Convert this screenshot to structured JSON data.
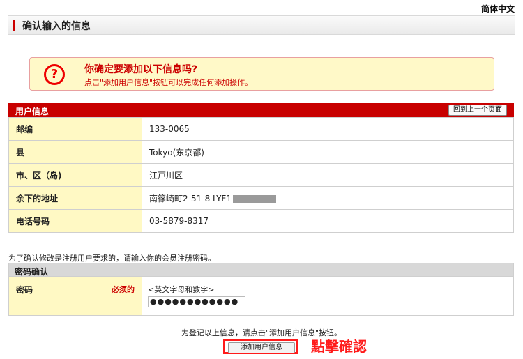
{
  "language": "简体中文",
  "page_title": "确认输入的信息",
  "alert": {
    "icon": "question-icon",
    "heading": "你确定要添加以下信息吗?",
    "subtext": "点击\"添加用户信息\"按钮可以完成任何添加操作。"
  },
  "user_info": {
    "header": "用户信息",
    "back_button": "回到上一个页面",
    "rows": [
      {
        "label": "邮编",
        "value": "133-0065"
      },
      {
        "label": "县",
        "value": "Tokyo(东京都)"
      },
      {
        "label": "市、区（岛)",
        "value": "江戸川区"
      },
      {
        "label": "余下的地址",
        "value": "南篠崎町2-51-8 LYF1"
      },
      {
        "label": "电话号码",
        "value": "03-5879-8317"
      }
    ]
  },
  "password_note": "为了确认修改是注册用户要求的，请输入你的会员注册密码。",
  "password": {
    "header": "密码确认",
    "label": "密码",
    "required": "必须的",
    "hint": "<英文字母和数字>",
    "value": "●●●●●●●●●●●●"
  },
  "bottom_note": "为登记以上信息，请点击\"添加用户信息\"按钮。",
  "submit_button": "添加用户信息",
  "annotation": "點擊確認",
  "colors": {
    "accent": "#c80000",
    "label_bg": "#fff9c4",
    "annotation": "#ff1a1a"
  }
}
